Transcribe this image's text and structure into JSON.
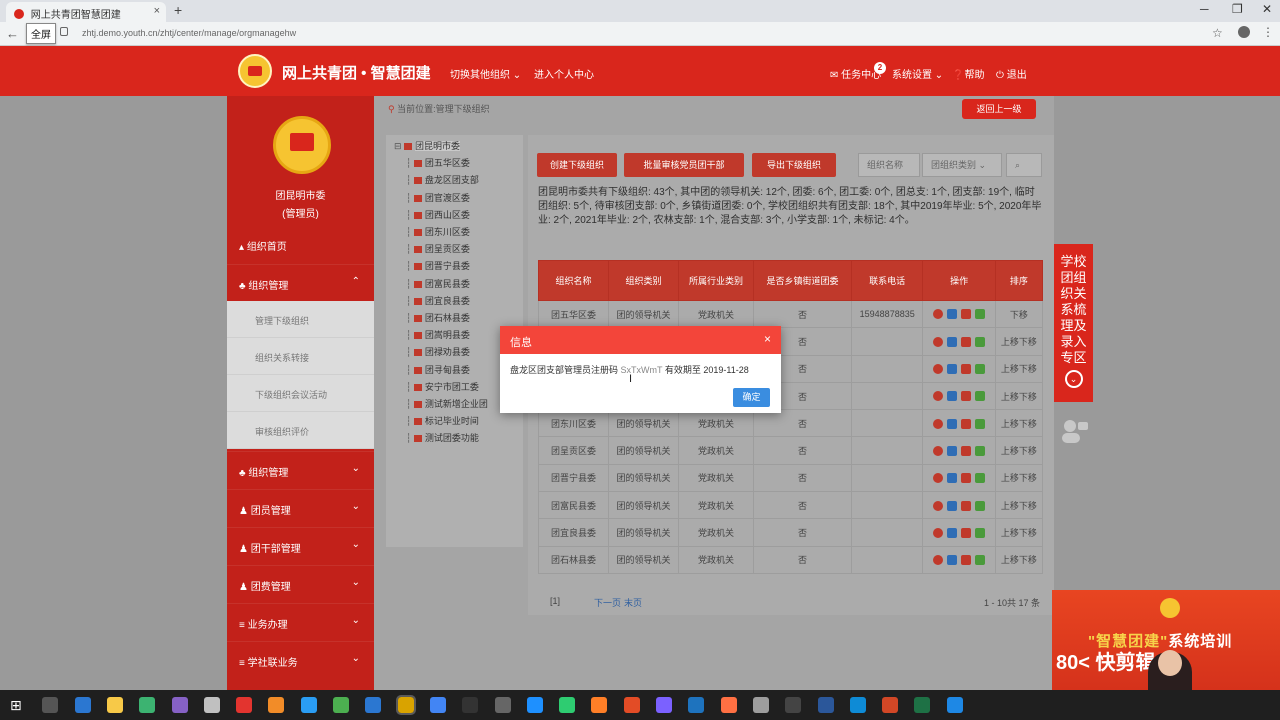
{
  "browser": {
    "tab_title": "网上共青团智慧团建",
    "new_tab": "+",
    "url": "zhtj.demo.youth.cn/zhtj/center/manage/orgmanagehw",
    "fullscreen_hint": "全屏",
    "win_min": "─",
    "win_restore": "❐",
    "win_close": "✕"
  },
  "header": {
    "site_title": "网上共青团 • 智慧团建",
    "switch_org": "切换其他组织",
    "personal": "进入个人中心",
    "tasks": "任务中心",
    "tasks_badge": "2",
    "settings": "系统设置",
    "help": "帮助",
    "logout": "退出"
  },
  "sidebar": {
    "org_name": "团昆明市委",
    "org_role": "(管理员)",
    "home": "组织首页",
    "org_mgmt": "组织管理",
    "sub_items": [
      "管理下级组织",
      "组织关系转接",
      "下级组织会议活动",
      "审核组织评价"
    ],
    "groups": [
      "组织管理",
      "团员管理",
      "团干部管理",
      "团费管理",
      "业务办理",
      "学社联业务"
    ]
  },
  "content": {
    "breadcrumb": "当前位置:管理下级组织",
    "back_button": "返回上一级",
    "tree": [
      {
        "label": "团昆明市委",
        "level": 0
      },
      {
        "label": "团五华区委",
        "level": 1
      },
      {
        "label": "盘龙区团支部",
        "level": 1
      },
      {
        "label": "团官渡区委",
        "level": 1
      },
      {
        "label": "团西山区委",
        "level": 1
      },
      {
        "label": "团东川区委",
        "level": 1
      },
      {
        "label": "团呈贡区委",
        "level": 1
      },
      {
        "label": "团晋宁县委",
        "level": 1
      },
      {
        "label": "团富民县委",
        "level": 1
      },
      {
        "label": "团宜良县委",
        "level": 1
      },
      {
        "label": "团石林县委",
        "level": 1
      },
      {
        "label": "团嵩明县委",
        "level": 1
      },
      {
        "label": "团禄劝县委",
        "level": 1
      },
      {
        "label": "团寻甸县委",
        "level": 1
      },
      {
        "label": "安宁市团工委",
        "level": 1
      },
      {
        "label": "测试新增企业团",
        "level": 1
      },
      {
        "label": "标记毕业时间",
        "level": 1
      },
      {
        "label": "测试团委功能",
        "level": 1
      }
    ],
    "toolbar": {
      "create": "创建下级组织",
      "batch": "批量审核党员团干部",
      "export": "导出下级组织",
      "search_type": "组织名称",
      "filter": "团组织类别",
      "search_icon": "⌕"
    },
    "summary": "团昆明市委共有下级组织: 43个, 其中团的领导机关: 12个, 团委: 6个, 团工委: 0个, 团总支: 1个, 团支部: 19个, 临时团组织: 5个, 待审核团支部: 0个, 乡镇街道团委: 0个, 学校团组织共有团支部: 18个, 其中2019年毕业: 5个, 2020年毕业: 2个, 2021年毕业: 2个, 农林支部: 1个, 混合支部: 3个, 小学支部: 1个, 未标记: 4个。",
    "table": {
      "headers": [
        "组织名称",
        "组织类别",
        "所属行业类别",
        "是否乡镇街道团委",
        "联系电话",
        "操作",
        "排序"
      ],
      "rows": [
        [
          "团五华区委",
          "团的领导机关",
          "党政机关",
          "否",
          "15948878835",
          "",
          "下移"
        ],
        [
          "盘龙区团支部",
          "团的领导机关",
          "党政机关",
          "否",
          "",
          "",
          "上移下移"
        ],
        [
          "团官渡区委",
          "团的领导机关",
          "党政机关",
          "否",
          "",
          "",
          "上移下移"
        ],
        [
          "团西山区委",
          "团的领导机关",
          "党政机关",
          "否",
          "",
          "",
          "上移下移"
        ],
        [
          "团东川区委",
          "团的领导机关",
          "党政机关",
          "否",
          "",
          "",
          "上移下移"
        ],
        [
          "团呈贡区委",
          "团的领导机关",
          "党政机关",
          "否",
          "",
          "",
          "上移下移"
        ],
        [
          "团晋宁县委",
          "团的领导机关",
          "党政机关",
          "否",
          "",
          "",
          "上移下移"
        ],
        [
          "团富民县委",
          "团的领导机关",
          "党政机关",
          "否",
          "",
          "",
          "上移下移"
        ],
        [
          "团宜良县委",
          "团的领导机关",
          "党政机关",
          "否",
          "",
          "",
          "上移下移"
        ],
        [
          "团石林县委",
          "团的领导机关",
          "党政机关",
          "否",
          "",
          "",
          "上移下移"
        ]
      ]
    },
    "pager": {
      "page": "[1]",
      "next": "下一页",
      "last": "末页",
      "range": "1 - 10共 17 条"
    }
  },
  "side_tab": {
    "text": "学校团组织关系梳理及录入专区",
    "arrow": "⌄"
  },
  "dialog": {
    "title": "信息",
    "close": "×",
    "message": "盘龙区团支部管理员注册码",
    "code": "SxTxWmT",
    "message_tail": "有效期至 2019-11-28",
    "ok": "确定"
  },
  "video": {
    "title_a": "\"智慧团建\"",
    "title_b": "系统培训",
    "brand": "80< 快剪辑"
  },
  "taskbar": {
    "icon_colors": [
      "#ffffff",
      "#555555",
      "#2b77d1",
      "#f7c948",
      "#3cb371",
      "#8661c5",
      "#c0c0c0",
      "#e3342f",
      "#f28c28",
      "#2a9df4",
      "#4caf50",
      "#2b77d1",
      "#d9a300",
      "#4285f4",
      "#333333",
      "#666666",
      "#1e90ff",
      "#2ecc71",
      "#ff7f27",
      "#e34c26",
      "#7b61ff",
      "#1e73be",
      "#ff7043",
      "#9e9e9e",
      "#444444",
      "#2b579a",
      "#0e8bd6",
      "#d24726",
      "#1e7145",
      "#1e88e5"
    ]
  },
  "colors": {
    "brand_red": "#d9261c",
    "sidebar_red": "#c2211a",
    "dialog_red": "#f3453a",
    "ok_blue": "#3a8de0"
  }
}
